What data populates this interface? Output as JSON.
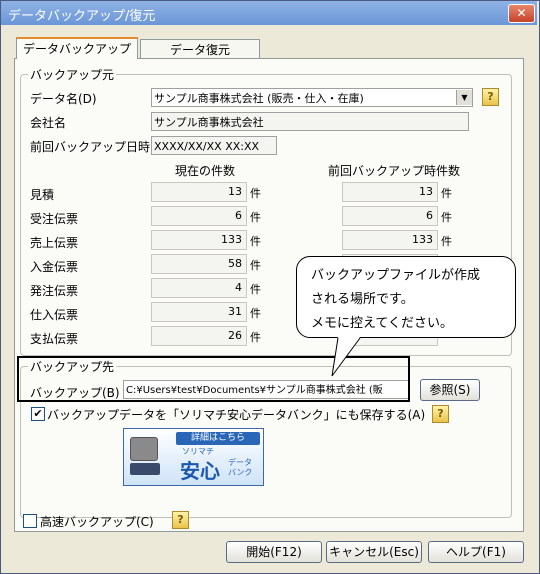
{
  "window": {
    "title": "データバックアップ/復元",
    "close_glyph": "✕"
  },
  "tabs": [
    {
      "label": "データバックアップ"
    },
    {
      "label": "データ復元"
    }
  ],
  "source": {
    "legend": "バックアップ元",
    "data_name_label": "データ名(D)",
    "data_name_value": "サンプル商事株式会社 (販売・仕入・在庫)",
    "company_label": "会社名",
    "company_value": "サンプル商事株式会社",
    "last_backup_label": "前回バックアップ日時",
    "last_backup_value": "XXXX/XX/XX XX:XX",
    "col_current": "現在の件数",
    "col_previous": "前回バックアップ時件数",
    "rows": [
      {
        "label": "見積",
        "current": "13",
        "previous": "13"
      },
      {
        "label": "受注伝票",
        "current": "6",
        "previous": "6"
      },
      {
        "label": "売上伝票",
        "current": "133",
        "previous": "133"
      },
      {
        "label": "入金伝票",
        "current": "58",
        "previous": ""
      },
      {
        "label": "発注伝票",
        "current": "4",
        "previous": ""
      },
      {
        "label": "仕入伝票",
        "current": "31",
        "previous": ""
      },
      {
        "label": "支払伝票",
        "current": "26",
        "previous": ""
      }
    ],
    "unit": "件"
  },
  "dest": {
    "legend": "バックアップ先",
    "path_label": "バックアップ(B)",
    "path_value": "C:¥Users¥test¥Documents¥サンプル商事株式会社 (販",
    "browse_label": "参照(S)",
    "checkbox_label": "バックアップデータを「ソリマチ安心データバンク」にも保存する(A)",
    "checkbox_checked": true
  },
  "banner": {
    "top": "詳細はこちら",
    "brand": "ソリマチ",
    "main": "安心",
    "sub1": "データ",
    "sub2": "バンク"
  },
  "fast_backup_label": "高速バックアップ(C)",
  "callout": {
    "line1": "バックアップファイルが作成",
    "line2": "される場所です。",
    "line3": "メモに控えてください。"
  },
  "buttons": {
    "start": "開始(F12)",
    "cancel": "キャンセル(Esc)",
    "help": "ヘルプ(F1)"
  },
  "help_glyph": "?",
  "checkmark": "✔",
  "colors": {
    "title_bar": "#7aa2dc",
    "callout_border": "#000000",
    "highlight_box": "#000000"
  }
}
